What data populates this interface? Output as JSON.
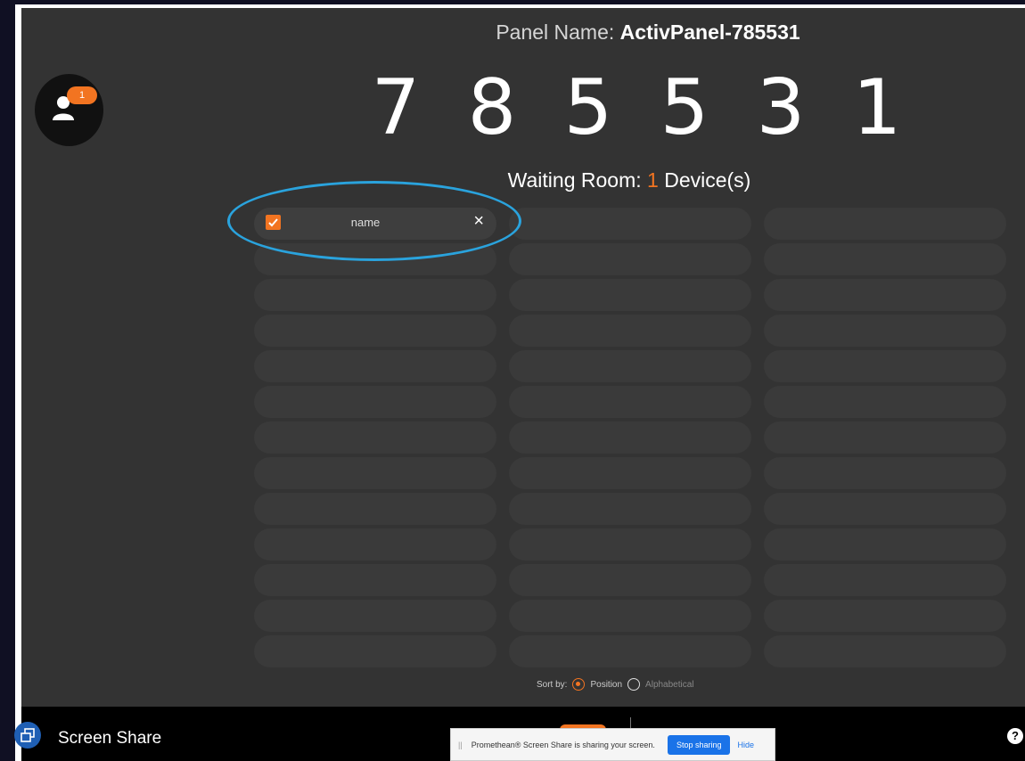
{
  "panel": {
    "label": "Panel Name:",
    "name": "ActivPanel-785531",
    "digits": [
      "7",
      "8",
      "5",
      "5",
      "3",
      "1"
    ]
  },
  "avatar": {
    "badge_count": "1",
    "icon": "users-icon"
  },
  "waiting_room": {
    "prefix": "Waiting Room:",
    "count": "1",
    "suffix": "Device(s)"
  },
  "devices": [
    {
      "name": "name",
      "checked": true
    }
  ],
  "sort": {
    "label": "Sort by:",
    "options": [
      "Position",
      "Alphabetical"
    ],
    "selected": "Position"
  },
  "taskbar": {
    "app_label": "Screen Share",
    "help_icon": "help-icon"
  },
  "share_notification": {
    "grip": "||",
    "message": "Promethean® Screen Share is sharing your screen.",
    "stop_label": "Stop sharing",
    "hide_label": "Hide"
  },
  "colors": {
    "accent": "#f27421",
    "highlight_ring": "#2aa3dd",
    "background": "#333333"
  }
}
